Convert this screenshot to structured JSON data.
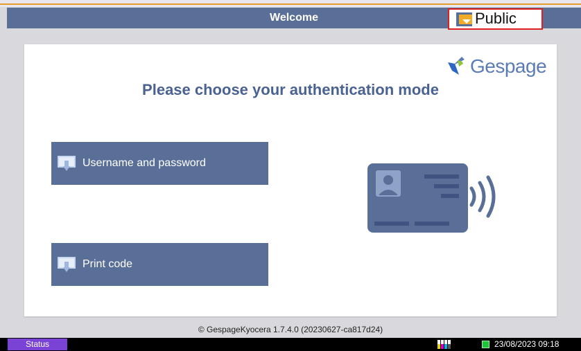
{
  "header": {
    "title": "Welcome",
    "queue_label": "Public"
  },
  "main": {
    "logo_text": "Gespage",
    "heading": "Please choose your authentication mode",
    "buttons": [
      {
        "label": "Username and password",
        "icon": "user-login-icon"
      },
      {
        "label": "Print code",
        "icon": "print-code-icon"
      }
    ],
    "illustration": "contactless-card-icon"
  },
  "footer": {
    "copyright": "© GespageKyocera 1.7.4.0 (20230627-ca817d24)"
  },
  "status_bar": {
    "status_label": "Status",
    "datetime": "23/08/2023  09:18",
    "toner_icon": "toner-level-icon",
    "network_icon": "network-status-icon"
  },
  "colors": {
    "accent": "#5a6f98",
    "heading": "#4a6291",
    "highlight_border": "#e0201e",
    "status_button": "#7b42d6",
    "top_stripe": "#e39b2f"
  }
}
